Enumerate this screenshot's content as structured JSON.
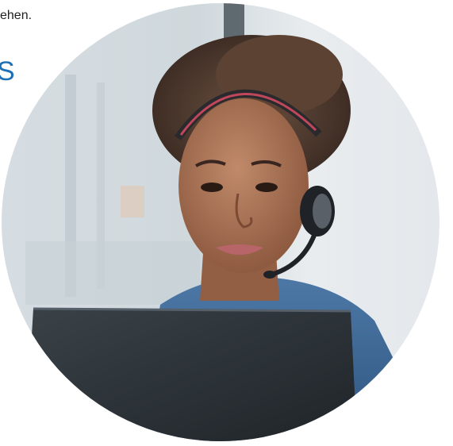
{
  "snippet": {
    "text_fragment": "ehen.",
    "heading_fragment": "S"
  },
  "hero_image": {
    "subject": "woman-with-headset-at-laptop"
  },
  "colors": {
    "heading_blue": "#1f6fb4",
    "text_dark": "#1f1f1f",
    "denim": "#3f6a9a",
    "laptop": "#2d3338",
    "background_light": "#dfe5ea"
  }
}
